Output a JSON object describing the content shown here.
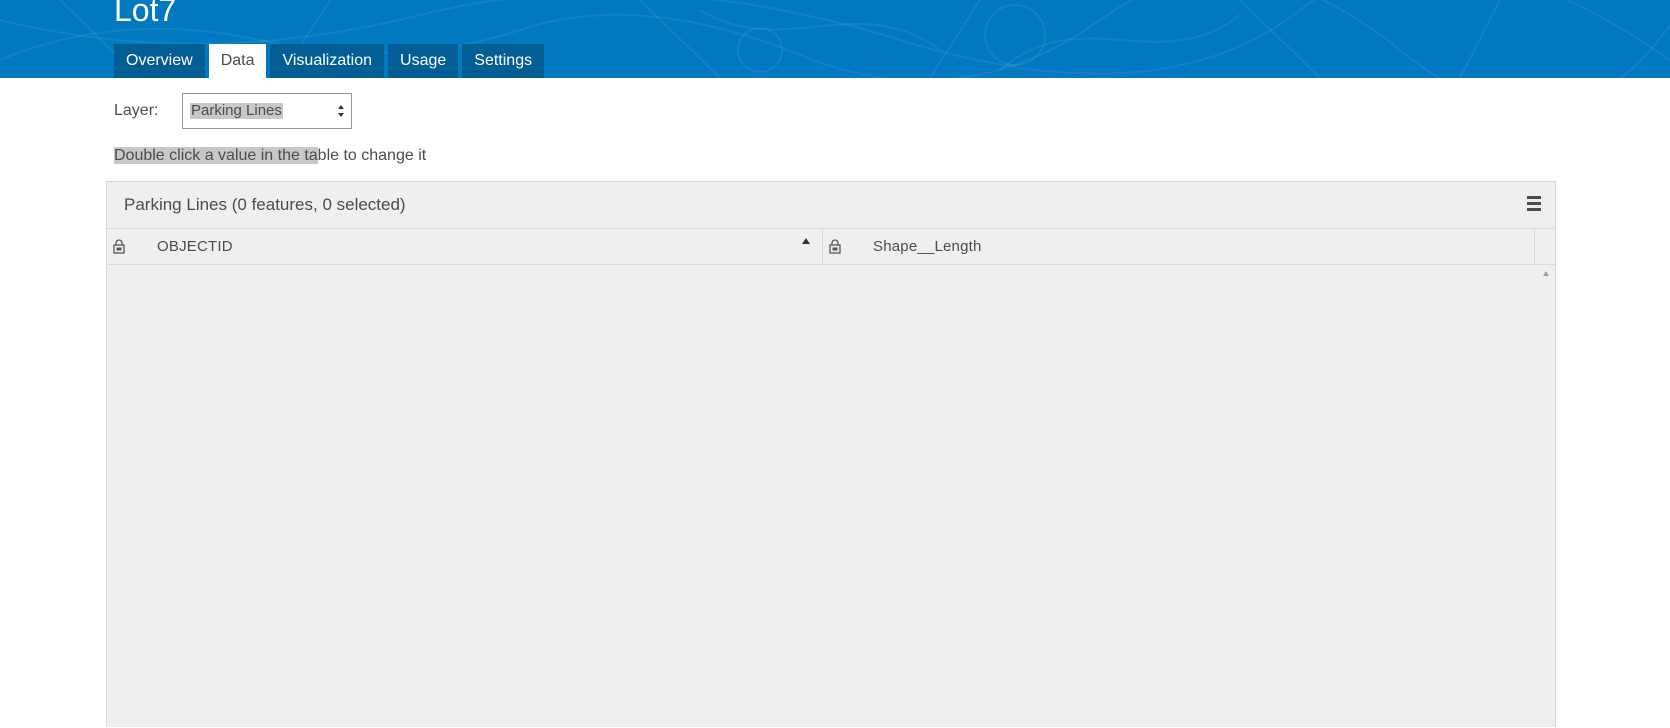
{
  "item": {
    "title": "Lot7"
  },
  "tabs": [
    {
      "label": "Overview",
      "active": false
    },
    {
      "label": "Data",
      "active": true
    },
    {
      "label": "Visualization",
      "active": false
    },
    {
      "label": "Usage",
      "active": false
    },
    {
      "label": "Settings",
      "active": false
    }
  ],
  "layer": {
    "label": "Layer:",
    "selected": "Parking Lines"
  },
  "hint": {
    "highlighted": "Double click a value in the ta",
    "rest": "ble to change it"
  },
  "grid": {
    "title": "Parking Lines (0 features, 0 selected)",
    "columns": [
      {
        "label": "OBJECTID",
        "locked": true,
        "sorted": "ascending"
      },
      {
        "label": "Shape__Length",
        "locked": true,
        "sorted": "none"
      }
    ],
    "rows": []
  },
  "colors": {
    "banner": "#0079c1",
    "tab_inactive": "#005e95",
    "grid_bg": "#efefef",
    "highlight": "#c8c8c8"
  },
  "icons": {
    "lock": "lock-icon",
    "menu": "hamburger-menu-icon",
    "sort": "sort-ascending-icon",
    "select_arrows": "select-arrows-icon",
    "scroll_up": "scroll-up-arrow-icon"
  }
}
